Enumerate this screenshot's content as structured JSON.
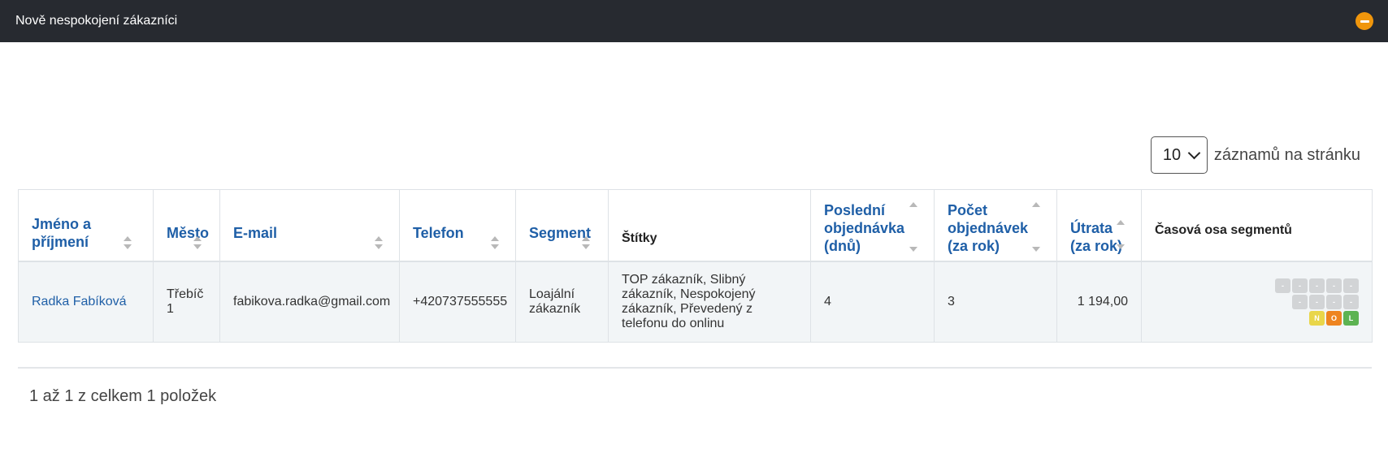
{
  "panel": {
    "title": "Nově nespokojení zákazníci"
  },
  "pagination": {
    "page_size": "10",
    "per_page_label": "záznamů na stránku",
    "summary": "1 až 1 z celkem 1 položek"
  },
  "table": {
    "headers": {
      "name": "Jméno a příjmení",
      "city": "Město",
      "email": "E-mail",
      "phone": "Telefon",
      "segment": "Segment",
      "tags": "Štítky",
      "last_order": "Poslední objednávka (dnů)",
      "order_count": "Počet objednávek (za rok)",
      "spend": "Útrata (za rok)",
      "timeline": "Časová osa segmentů"
    },
    "rows": [
      {
        "name": "Radka Fabíková",
        "city": "Třebíč 1",
        "email": "fabikova.radka@gmail.com",
        "phone": "+420737555555",
        "segment": "Loajální zákazník",
        "tags": "TOP zákazník, Slibný zákazník, Nespokojený zákazník, Převedený z telefonu do onlinu",
        "last_order": "4",
        "order_count": "3",
        "spend": "1 194,00",
        "timeline": {
          "row1": [
            "-",
            "-",
            "-",
            "-",
            "-"
          ],
          "row2": [
            "-",
            "-",
            "-",
            "-"
          ],
          "row3": [
            "N",
            "O",
            "L"
          ]
        }
      }
    ]
  },
  "colors": {
    "topbar": "#272a30",
    "accent": "#f0960c",
    "link": "#1f5fa7",
    "segment_n": "#e9d64a",
    "segment_o": "#ee8420",
    "segment_l": "#5db352",
    "segment_empty": "#d2d4d6"
  },
  "icons": {
    "collapse": "minus-circle-icon",
    "select": "chevron-down-icon",
    "sort": "sort-arrows-icon"
  }
}
